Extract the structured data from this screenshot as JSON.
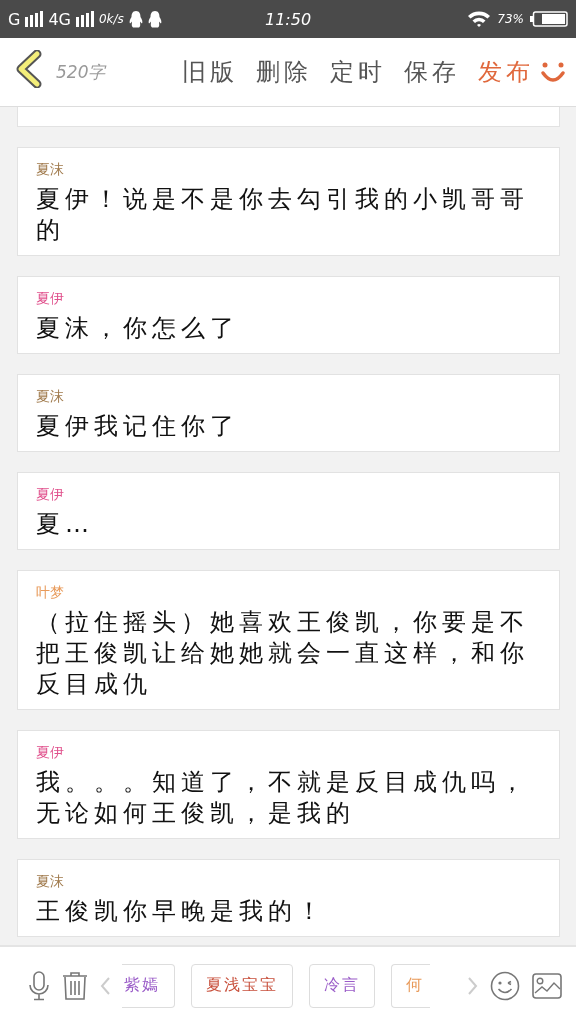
{
  "status_bar": {
    "network_1": "G",
    "network_2": "4G",
    "speed": "0k/s",
    "time": "11:50",
    "battery": "73%"
  },
  "toolbar": {
    "word_count": "520字",
    "actions": [
      {
        "label": "旧版",
        "kind": "plain"
      },
      {
        "label": "删除",
        "kind": "plain"
      },
      {
        "label": "定时",
        "kind": "plain"
      },
      {
        "label": "保存",
        "kind": "plain"
      },
      {
        "label": "发布",
        "kind": "primary"
      }
    ]
  },
  "messages": [
    {
      "speaker": "夏沫",
      "color": "#a07a4c",
      "text": "夏伊！说是不是你去勾引我的小凯哥哥的"
    },
    {
      "speaker": "夏伊",
      "color": "#e0508c",
      "text": "夏沫，你怎么了"
    },
    {
      "speaker": "夏沫",
      "color": "#a07a4c",
      "text": "夏伊我记住你了"
    },
    {
      "speaker": "夏伊",
      "color": "#e0508c",
      "text": "夏…"
    },
    {
      "speaker": "叶梦",
      "color": "#e89a5a",
      "text": "（拉住摇头）她喜欢王俊凯，你要是不把王俊凯让给她她就会一直这样，和你反目成仇"
    },
    {
      "speaker": "夏伊",
      "color": "#e0508c",
      "text": "我。。。知道了，不就是反目成仇吗，无论如何王俊凯，是我的"
    },
    {
      "speaker": "夏沫",
      "color": "#a07a4c",
      "text": "王俊凯你早晚是我的！"
    }
  ],
  "characters": [
    {
      "name": "紫嫣",
      "color": "#9a5cc8"
    },
    {
      "name": "夏浅宝宝",
      "color": "#c8503c"
    },
    {
      "name": "冷言",
      "color": "#9a5cc8"
    },
    {
      "name": "何",
      "color": "#e89a5a"
    }
  ]
}
